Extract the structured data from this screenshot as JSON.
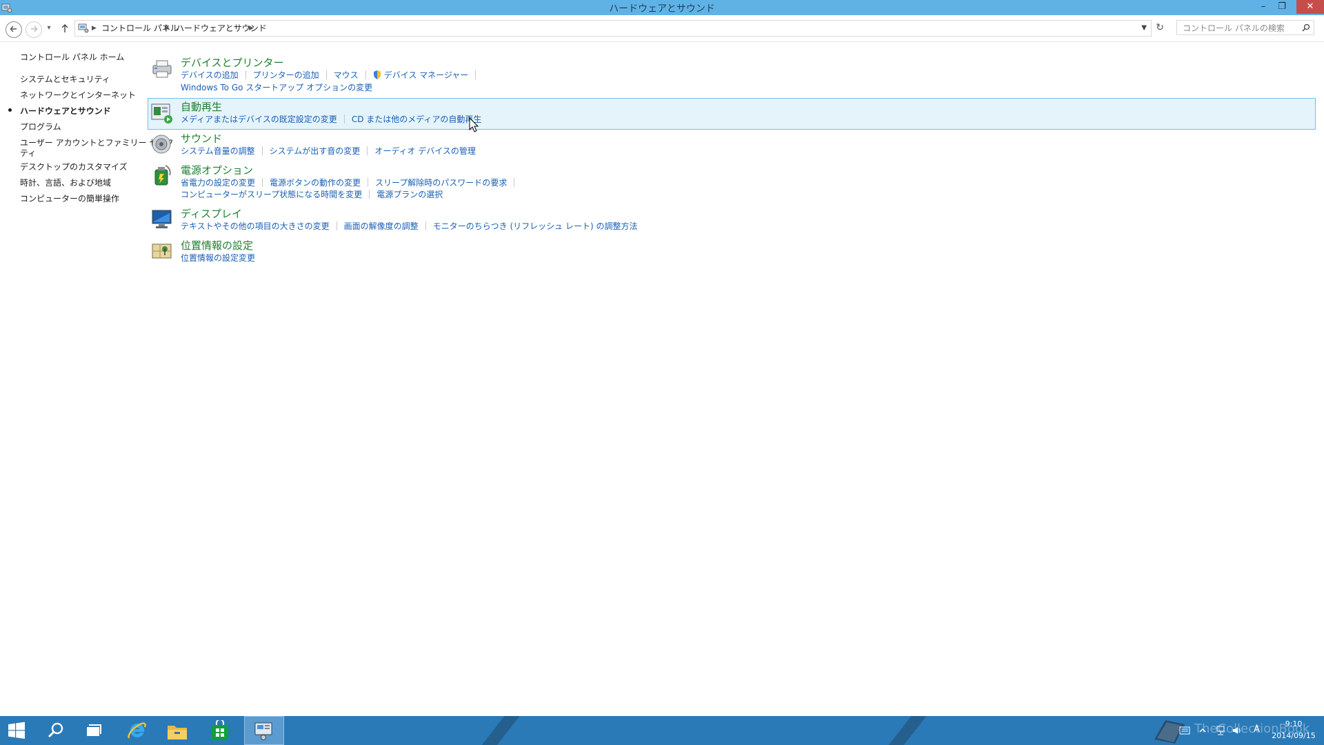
{
  "window": {
    "title": "ハードウェアとサウンド",
    "minimize": "–",
    "maximize": "❐",
    "close": "✕"
  },
  "addressbar": {
    "crumbs": [
      "コントロール パネル",
      "ハードウェアとサウンド"
    ],
    "search_placeholder": "コントロール パネルの検索"
  },
  "leftnav": {
    "items": [
      {
        "label": "コントロール パネル ホーム"
      },
      {
        "label": "システムとセキュリティ"
      },
      {
        "label": "ネットワークとインターネット"
      },
      {
        "label": "ハードウェアとサウンド"
      },
      {
        "label": "プログラム"
      },
      {
        "label": "ユーザー アカウントとファミリー セーフ"
      },
      {
        "label": "ティ"
      },
      {
        "label": "デスクトップのカスタマイズ"
      },
      {
        "label": "時計、言語、および地域"
      },
      {
        "label": "コンピューターの簡単操作"
      }
    ]
  },
  "categories": [
    {
      "title": "デバイスとプリンター",
      "rows": [
        [
          "デバイスの追加",
          "プリンターの追加",
          "マウス",
          "デバイス マネージャー"
        ],
        [
          "Windows To Go スタートアップ オプションの変更"
        ]
      ]
    },
    {
      "title": "自動再生",
      "rows": [
        [
          "メディアまたはデバイスの既定設定の変更",
          "CD または他のメディアの自動再生"
        ]
      ]
    },
    {
      "title": "サウンド",
      "rows": [
        [
          "システム音量の調整",
          "システムが出す音の変更",
          "オーディオ デバイスの管理"
        ]
      ]
    },
    {
      "title": "電源オプション",
      "rows": [
        [
          "省電力の設定の変更",
          "電源ボタンの動作の変更",
          "スリープ解除時のパスワードの要求"
        ],
        [
          "コンピューターがスリープ状態になる時間を変更",
          "電源プランの選択"
        ]
      ]
    },
    {
      "title": "ディスプレイ",
      "rows": [
        [
          "テキストやその他の項目の大きさの変更",
          "画面の解像度の調整",
          "モニターのちらつき (リフレッシュ レート) の調整方法"
        ]
      ]
    },
    {
      "title": "位置情報の設定",
      "rows": [
        [
          "位置情報の設定変更"
        ]
      ]
    }
  ],
  "taskbar": {
    "clock_time": "9:10",
    "clock_date": "2014/09/15",
    "ime": "A",
    "watermark": "TheCollectionBook"
  },
  "colors": {
    "titlebar": "#5fb2e6",
    "category_title": "#1e7f30",
    "link": "#1a5fb4",
    "taskbar": "#2a7ab8"
  }
}
